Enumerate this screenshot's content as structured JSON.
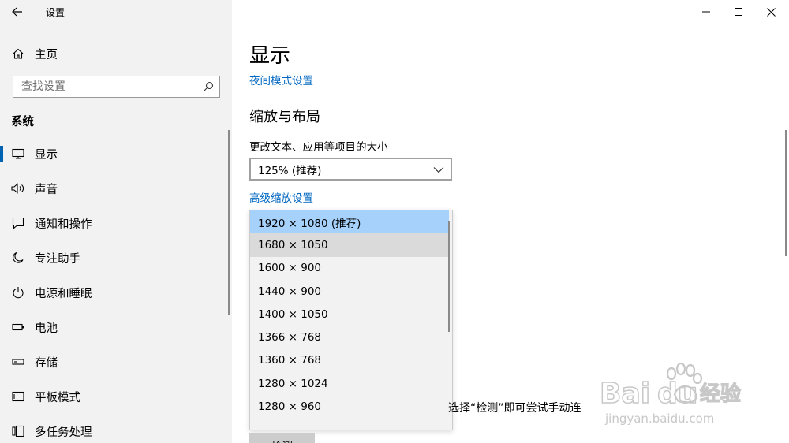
{
  "window": {
    "title": "设置"
  },
  "sidebar": {
    "home_label": "主页",
    "search_placeholder": "查找设置",
    "section_title": "系统",
    "items": [
      {
        "label": "显示",
        "icon": "monitor-icon",
        "active": true
      },
      {
        "label": "声音",
        "icon": "speaker-icon"
      },
      {
        "label": "通知和操作",
        "icon": "message-icon"
      },
      {
        "label": "专注助手",
        "icon": "moon-icon"
      },
      {
        "label": "电源和睡眠",
        "icon": "power-icon"
      },
      {
        "label": "电池",
        "icon": "battery-icon"
      },
      {
        "label": "存储",
        "icon": "storage-icon"
      },
      {
        "label": "平板模式",
        "icon": "tablet-icon"
      },
      {
        "label": "多任务处理",
        "icon": "multitask-icon"
      }
    ]
  },
  "main": {
    "page_title": "显示",
    "night_light_link": "夜间模式设置",
    "scale_section_title": "缩放与布局",
    "scale_label": "更改文本、应用等项目的大小",
    "scale_value": "125% (推荐)",
    "advanced_scaling_link": "高级缩放设置",
    "resolution_options": [
      "1920 × 1080 (推荐)",
      "1680 × 1050",
      "1600 × 900",
      "1440 × 900",
      "1400 × 1050",
      "1366 × 768",
      "1360 × 768",
      "1280 × 1024",
      "1280 × 960"
    ],
    "selected_resolution_index": 0,
    "hovered_resolution_index": 1,
    "partial_text": "选择“检测”即可尝试手动连",
    "detect_button": "检测"
  },
  "watermark": {
    "brand": "Baidu",
    "brand_cn": "经验",
    "url": "jingyan.baidu.com"
  },
  "colors": {
    "accent": "#0063b1",
    "link": "#0067c0",
    "sidebar_bg": "#f2f2f2",
    "selected": "#a6d1fb"
  }
}
